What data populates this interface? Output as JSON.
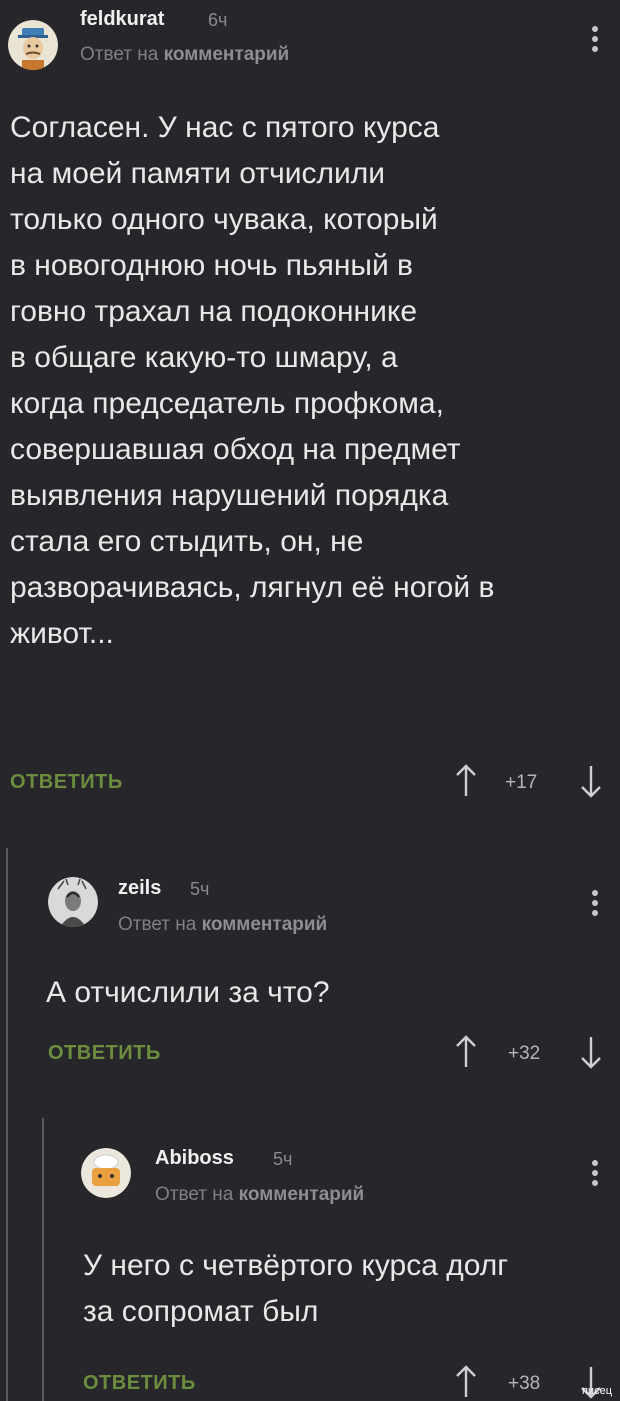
{
  "comments": [
    {
      "author": "feldkurat",
      "time": "6ч",
      "reply_prefix": "Ответ на",
      "reply_target": "комментарий",
      "text": "Согласен. У нас с пятого курса\nна моей памяти отчислили\nтолько одного чувака, который\nв новогоднюю ночь пьяный в\nговно трахал на подоконнике\nв общаге какую-то шмару, а\nкогда председатель профкома,\nсовершавшая обход на предмет\nвыявления нарушений порядка\nстала его стыдить, он, не\nразворачиваясь, лягнул её ногой в\nживот...",
      "reply_label": "ОТВЕТИТЬ",
      "rating": "+17"
    },
    {
      "author": "zeils",
      "time": "5ч",
      "reply_prefix": "Ответ на",
      "reply_target": "комментарий",
      "text": "А отчислили за что?",
      "reply_label": "ОТВЕТИТЬ",
      "rating": "+32"
    },
    {
      "author": "Abiboss",
      "time": "5ч",
      "reply_prefix": "Ответ на",
      "reply_target": "комментарий",
      "text": "У него с четвёртого курса долг\nза сопромат был",
      "reply_label": "ОТВЕТИТЬ",
      "rating": "+38"
    }
  ],
  "watermark": "писец",
  "colors": {
    "background": "#27272b",
    "reply_button": "#6c8d3e",
    "thread_line": "#5a5a5e"
  },
  "icons": [
    "avatar-feldkurat",
    "avatar-zeils",
    "avatar-abiboss",
    "more-vertical-icon",
    "arrow-up-icon",
    "arrow-down-icon"
  ]
}
